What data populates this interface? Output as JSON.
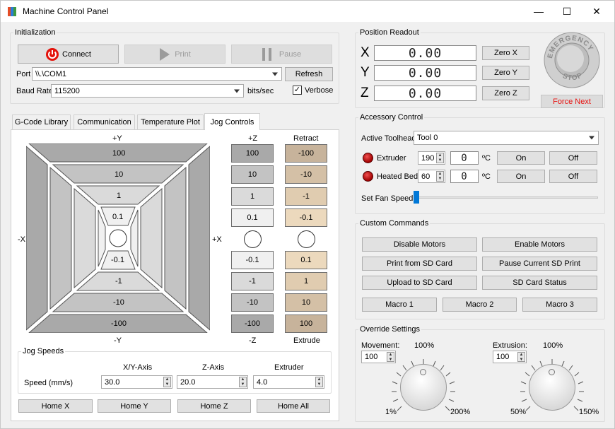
{
  "window": {
    "title": "Machine Control Panel",
    "minimize": "—",
    "maximize": "☐",
    "close": "✕"
  },
  "initialization": {
    "legend": "Initialization",
    "connect": "Connect",
    "print": "Print",
    "pause": "Pause",
    "port_label": "Port",
    "port_value": "\\\\.\\COM1",
    "refresh": "Refresh",
    "baud_label": "Baud Rate",
    "baud_value": "115200",
    "baud_unit": "bits/sec",
    "verbose_label": "Verbose",
    "verbose_checked": true
  },
  "tabs": [
    {
      "label": "G-Code Library"
    },
    {
      "label": "Communication"
    },
    {
      "label": "Temperature Plot"
    },
    {
      "label": "Jog Controls",
      "active": true
    }
  ],
  "jog": {
    "plus_y": "+Y",
    "minus_y": "-Y",
    "minus_x": "-X",
    "plus_x": "+X",
    "xy_top": [
      "100",
      "10",
      "1",
      "0.1"
    ],
    "xy_bottom": [
      "-0.1",
      "-1",
      "-10",
      "-100"
    ],
    "plus_z": "+Z",
    "minus_z": "-Z",
    "z_top": [
      "100",
      "10",
      "1",
      "0.1"
    ],
    "z_bottom": [
      "-0.1",
      "-1",
      "-10",
      "-100"
    ],
    "retract": "Retract",
    "extrude": "Extrude",
    "e_top": [
      "-100",
      "-10",
      "-1",
      "-0.1"
    ],
    "e_bottom": [
      "0.1",
      "1",
      "10",
      "100"
    ]
  },
  "jog_speeds": {
    "legend": "Jog Speeds",
    "col_xy": "X/Y-Axis",
    "col_z": "Z-Axis",
    "col_e": "Extruder",
    "row_label": "Speed (mm/s)",
    "xy": "30.0",
    "z": "20.0",
    "e": "4.0"
  },
  "home": {
    "x": "Home X",
    "y": "Home Y",
    "z": "Home Z",
    "all": "Home All"
  },
  "position": {
    "legend": "Position Readout",
    "x_label": "X",
    "y_label": "Y",
    "z_label": "Z",
    "x_value": "0.00",
    "y_value": "0.00",
    "z_value": "0.00",
    "zero_x": "Zero X",
    "zero_y": "Zero Y",
    "zero_z": "Zero Z",
    "estop_top": "EMERGENCY",
    "estop_bottom": "STOP",
    "force_next": "Force Next"
  },
  "accessory": {
    "legend": "Accessory Control",
    "toolhead_label": "Active Toolhead",
    "toolhead_value": "Tool 0",
    "extruder_label": "Extruder",
    "extruder_set": "190",
    "extruder_temp": "0",
    "bed_label": "Heated Bed",
    "bed_set": "60",
    "bed_temp": "0",
    "unit": "ºC",
    "on": "On",
    "off": "Off",
    "fan_label": "Set Fan Speed",
    "fan_level": 0
  },
  "custom": {
    "legend": "Custom Commands",
    "disable_motors": "Disable Motors",
    "enable_motors": "Enable Motors",
    "print_sd": "Print from SD Card",
    "pause_sd": "Pause Current SD Print",
    "upload_sd": "Upload to SD Card",
    "sd_status": "SD Card Status",
    "macro1": "Macro 1",
    "macro2": "Macro 2",
    "macro3": "Macro 3"
  },
  "override": {
    "legend": "Override Settings",
    "movement_label": "Movement:",
    "movement_pct": "100%",
    "movement_value": "100",
    "movement_min": "1%",
    "movement_max": "200%",
    "extrusion_label": "Extrusion:",
    "extrusion_pct": "100%",
    "extrusion_value": "100",
    "extrusion_min": "50%",
    "extrusion_max": "150%"
  },
  "colors": {
    "accent": "#0078d7",
    "extrude_dark": "#c7b39b",
    "extrude_light": "#ecd9bd",
    "force_next": "#e8100e"
  }
}
